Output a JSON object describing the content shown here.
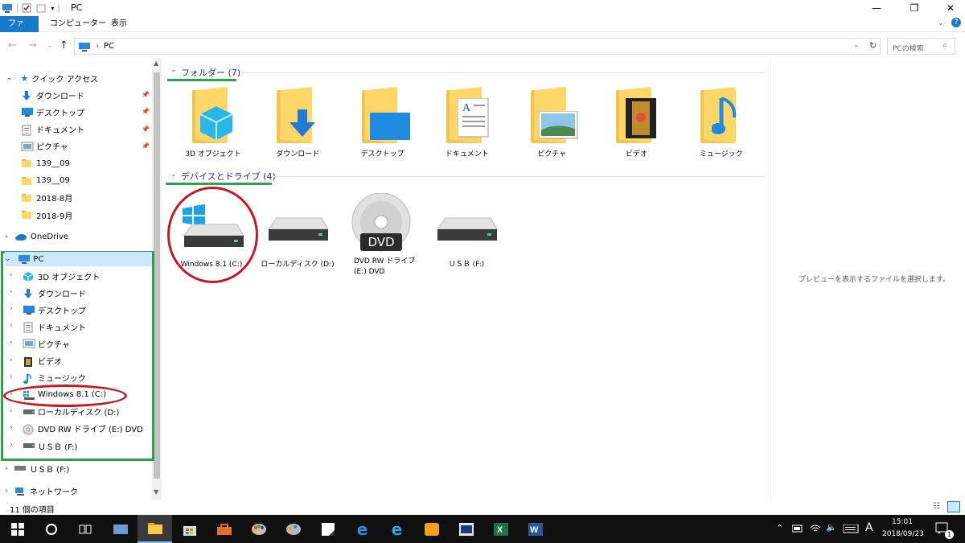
{
  "window": {
    "title": "PC",
    "min_glyph": "—",
    "restore_glyph": "❐",
    "close_glyph": "✕"
  },
  "ribbon": {
    "tabs": [
      "ファイル",
      "コンピューター",
      "表示"
    ]
  },
  "address": {
    "path": "PC",
    "search_placeholder": "PCの検索"
  },
  "nav": {
    "quick_access": "クイック アクセス",
    "quick_items": [
      {
        "label": "ダウンロード",
        "icon": "download-arrow-icon"
      },
      {
        "label": "デスクトップ",
        "icon": "desktop-icon"
      },
      {
        "label": "ドキュメント",
        "icon": "document-icon"
      },
      {
        "label": "ピクチャ",
        "icon": "picture-icon"
      },
      {
        "label": "139__09",
        "icon": "folder-icon"
      },
      {
        "label": "139__09",
        "icon": "folder-icon"
      },
      {
        "label": "2018-8月",
        "icon": "folder-icon"
      },
      {
        "label": "2018-9月",
        "icon": "folder-icon"
      }
    ],
    "onedrive": "OneDrive",
    "pc": "PC",
    "pc_items": [
      {
        "label": "3D オブジェクト",
        "icon": "3d-objects-icon"
      },
      {
        "label": "ダウンロード",
        "icon": "download-arrow-icon"
      },
      {
        "label": "デスクトップ",
        "icon": "desktop-icon"
      },
      {
        "label": "ドキュメント",
        "icon": "document-icon"
      },
      {
        "label": "ピクチャ",
        "icon": "picture-icon"
      },
      {
        "label": "ビデオ",
        "icon": "video-icon"
      },
      {
        "label": "ミュージック",
        "icon": "music-note-icon"
      },
      {
        "label": "Windows 8.1 (C:)",
        "icon": "windows-drive-icon"
      },
      {
        "label": "ローカルディスク (D:)",
        "icon": "drive-icon"
      },
      {
        "label": "DVD RW ドライブ (E:) DVD",
        "icon": "dvd-icon"
      },
      {
        "label": "ＵＳＢ (F:)",
        "icon": "drive-icon"
      }
    ],
    "usb": "ＵＳＢ (F:)",
    "network": "ネットワーク"
  },
  "main": {
    "folders_header": "フォルダー (7)",
    "folders": [
      "3D オブジェクト",
      "ダウンロード",
      "デスクトップ",
      "ドキュメント",
      "ピクチャ",
      "ビデオ",
      "ミュージック"
    ],
    "devices_header": "デバイスとドライブ (4)",
    "drives": [
      {
        "label": "Windows 8.1 (C:)"
      },
      {
        "label": "ローカルディスク (D:)"
      },
      {
        "label": "DVD RW ドライブ\n(E:) DVD"
      },
      {
        "label": "ＵＳＢ (F:)"
      }
    ],
    "dvd_badge": "DVD"
  },
  "preview": {
    "text": "プレビューを表示するファイルを選択します。"
  },
  "status": {
    "count": "11 個の項目"
  },
  "taskbar": {
    "time": "15:01",
    "date": "2018/09/23",
    "ime": "A",
    "notification_count": "1"
  },
  "colors": {
    "accent": "#1979ca",
    "annotation_red": "#c41a21",
    "annotation_green": "#2ca34a",
    "folder": "#ffd768"
  }
}
